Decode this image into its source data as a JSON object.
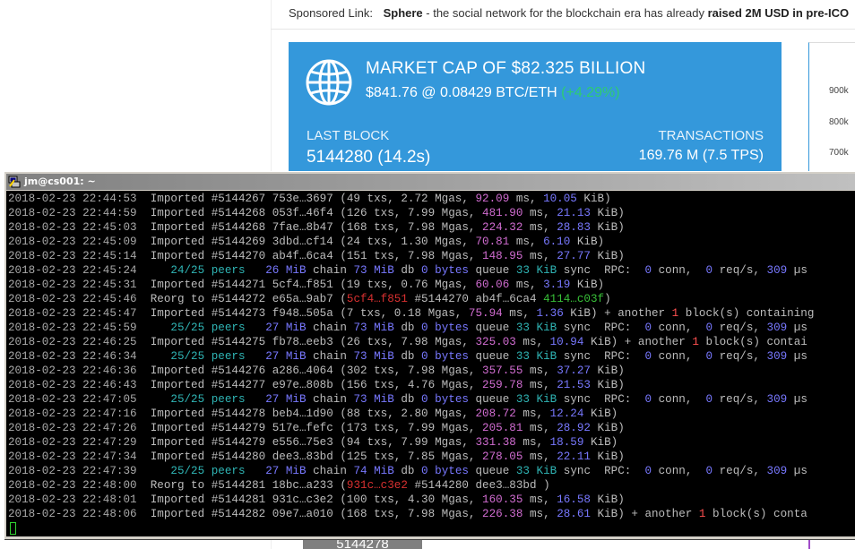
{
  "sponsor": {
    "label": "Sponsored Link:",
    "name": "Sphere",
    "text": " - the social network for the blockchain era has already ",
    "bold_tail": "raised 2M USD in pre-ICO"
  },
  "market": {
    "title": "MARKET CAP OF $82.325 BILLION",
    "price": "$841.76 @ 0.08429 BTC/ETH",
    "change": "(+4.29%)",
    "last_block_label": "LAST BLOCK",
    "last_block_value": "5144280 (14.2s)",
    "transactions_label": "TRANSACTIONS",
    "transactions_value": "169.76 M (7.5 TPS)",
    "brand_color": "#3498db",
    "change_color": "#2ecc71"
  },
  "side_chart": {
    "ticks": [
      "900k",
      "800k",
      "700k"
    ]
  },
  "bottom_value": "5144278",
  "terminal": {
    "title": "jm@cs001: ~",
    "lines": [
      [
        [
          "ts",
          "2018-02-23 22:44:53"
        ],
        [
          "w",
          "  Imported #5144267 753e…3697 (49 txs, 2.72 Mgas, "
        ],
        [
          "m",
          "92.09"
        ],
        [
          "w",
          " ms, "
        ],
        [
          "b",
          "10.05"
        ],
        [
          "w",
          " KiB)"
        ]
      ],
      [
        [
          "ts",
          "2018-02-23 22:44:59"
        ],
        [
          "w",
          "  Imported #5144268 053f…46f4 (126 txs, 7.99 Mgas, "
        ],
        [
          "m",
          "481.90"
        ],
        [
          "w",
          " ms, "
        ],
        [
          "b",
          "21.13"
        ],
        [
          "w",
          " KiB)"
        ]
      ],
      [
        [
          "ts",
          "2018-02-23 22:45:03"
        ],
        [
          "w",
          "  Imported #5144268 7fae…8b47 (168 txs, 7.98 Mgas, "
        ],
        [
          "m",
          "224.32"
        ],
        [
          "w",
          " ms, "
        ],
        [
          "b",
          "28.83"
        ],
        [
          "w",
          " KiB)"
        ]
      ],
      [
        [
          "ts",
          "2018-02-23 22:45:09"
        ],
        [
          "w",
          "  Imported #5144269 3dbd…cf14 (24 txs, 1.30 Mgas, "
        ],
        [
          "m",
          "70.81"
        ],
        [
          "w",
          " ms, "
        ],
        [
          "b",
          "6.10"
        ],
        [
          "w",
          " KiB)"
        ]
      ],
      [
        [
          "ts",
          "2018-02-23 22:45:14"
        ],
        [
          "w",
          "  Imported #5144270 ab4f…6ca4 (151 txs, 7.98 Mgas, "
        ],
        [
          "m",
          "148.95"
        ],
        [
          "w",
          " ms, "
        ],
        [
          "b",
          "27.77"
        ],
        [
          "w",
          " KiB)"
        ]
      ],
      [
        [
          "ts",
          "2018-02-23 22:45:24"
        ],
        [
          "c",
          "     24/25 peers"
        ],
        [
          "b",
          "   26 MiB"
        ],
        [
          "w",
          " chain "
        ],
        [
          "b",
          "73 MiB"
        ],
        [
          "w",
          " db "
        ],
        [
          "b",
          "0 bytes"
        ],
        [
          "w",
          " queue "
        ],
        [
          "c",
          "33 KiB"
        ],
        [
          "w",
          " sync  RPC:  "
        ],
        [
          "b",
          "0"
        ],
        [
          "w",
          " conn,  "
        ],
        [
          "b",
          "0"
        ],
        [
          "w",
          " req/s, "
        ],
        [
          "b",
          "309"
        ],
        [
          "w",
          " µs"
        ]
      ],
      [
        [
          "ts",
          "2018-02-23 22:45:31"
        ],
        [
          "w",
          "  Imported #5144271 5cf4…f851 (19 txs, 0.76 Mgas, "
        ],
        [
          "m",
          "60.06"
        ],
        [
          "w",
          " ms, "
        ],
        [
          "b",
          "3.19"
        ],
        [
          "w",
          " KiB)"
        ]
      ],
      [
        [
          "ts",
          "2018-02-23 22:45:46"
        ],
        [
          "w",
          "  Reorg to #5144272 e65a…9ab7 ("
        ],
        [
          "r",
          "5cf4…f851"
        ],
        [
          "w",
          " #5144270 ab4f…6ca4 "
        ],
        [
          "g",
          "4114…c03f"
        ],
        [
          "w",
          ")"
        ]
      ],
      [
        [
          "ts",
          "2018-02-23 22:45:47"
        ],
        [
          "w",
          "  Imported #5144273 f948…505a (7 txs, 0.18 Mgas, "
        ],
        [
          "m",
          "75.94"
        ],
        [
          "w",
          " ms, "
        ],
        [
          "b",
          "1.36"
        ],
        [
          "w",
          " KiB) + another "
        ],
        [
          "rm",
          "1"
        ],
        [
          "w",
          " block(s) containing"
        ]
      ],
      [
        [
          "ts",
          "2018-02-23 22:45:59"
        ],
        [
          "c",
          "     25/25 peers"
        ],
        [
          "b",
          "   27 MiB"
        ],
        [
          "w",
          " chain "
        ],
        [
          "b",
          "73 MiB"
        ],
        [
          "w",
          " db "
        ],
        [
          "b",
          "0 bytes"
        ],
        [
          "w",
          " queue "
        ],
        [
          "c",
          "33 KiB"
        ],
        [
          "w",
          " sync  RPC:  "
        ],
        [
          "b",
          "0"
        ],
        [
          "w",
          " conn,  "
        ],
        [
          "b",
          "0"
        ],
        [
          "w",
          " req/s, "
        ],
        [
          "b",
          "309"
        ],
        [
          "w",
          " µs"
        ]
      ],
      [
        [
          "ts",
          "2018-02-23 22:46:25"
        ],
        [
          "w",
          "  Imported #5144275 fb78…eeb3 (26 txs, 7.98 Mgas, "
        ],
        [
          "m",
          "325.03"
        ],
        [
          "w",
          " ms, "
        ],
        [
          "b",
          "10.94"
        ],
        [
          "w",
          " KiB) + another "
        ],
        [
          "rm",
          "1"
        ],
        [
          "w",
          " block(s) contai"
        ]
      ],
      [
        [
          "ts",
          "2018-02-23 22:46:34"
        ],
        [
          "c",
          "     25/25 peers"
        ],
        [
          "b",
          "   27 MiB"
        ],
        [
          "w",
          " chain "
        ],
        [
          "b",
          "73 MiB"
        ],
        [
          "w",
          " db "
        ],
        [
          "b",
          "0 bytes"
        ],
        [
          "w",
          " queue "
        ],
        [
          "c",
          "33 KiB"
        ],
        [
          "w",
          " sync  RPC:  "
        ],
        [
          "b",
          "0"
        ],
        [
          "w",
          " conn,  "
        ],
        [
          "b",
          "0"
        ],
        [
          "w",
          " req/s, "
        ],
        [
          "b",
          "309"
        ],
        [
          "w",
          " µs"
        ]
      ],
      [
        [
          "ts",
          "2018-02-23 22:46:36"
        ],
        [
          "w",
          "  Imported #5144276 a286…4064 (302 txs, 7.98 Mgas, "
        ],
        [
          "m",
          "357.55"
        ],
        [
          "w",
          " ms, "
        ],
        [
          "b",
          "37.27"
        ],
        [
          "w",
          " KiB)"
        ]
      ],
      [
        [
          "ts",
          "2018-02-23 22:46:43"
        ],
        [
          "w",
          "  Imported #5144277 e97e…808b (156 txs, 4.76 Mgas, "
        ],
        [
          "m",
          "259.78"
        ],
        [
          "w",
          " ms, "
        ],
        [
          "b",
          "21.53"
        ],
        [
          "w",
          " KiB)"
        ]
      ],
      [
        [
          "ts",
          "2018-02-23 22:47:05"
        ],
        [
          "c",
          "     25/25 peers"
        ],
        [
          "b",
          "   27 MiB"
        ],
        [
          "w",
          " chain "
        ],
        [
          "b",
          "73 MiB"
        ],
        [
          "w",
          " db "
        ],
        [
          "b",
          "0 bytes"
        ],
        [
          "w",
          " queue "
        ],
        [
          "c",
          "33 KiB"
        ],
        [
          "w",
          " sync  RPC:  "
        ],
        [
          "b",
          "0"
        ],
        [
          "w",
          " conn,  "
        ],
        [
          "b",
          "0"
        ],
        [
          "w",
          " req/s, "
        ],
        [
          "b",
          "309"
        ],
        [
          "w",
          " µs"
        ]
      ],
      [
        [
          "ts",
          "2018-02-23 22:47:16"
        ],
        [
          "w",
          "  Imported #5144278 beb4…1d90 (88 txs, 2.80 Mgas, "
        ],
        [
          "m",
          "208.72"
        ],
        [
          "w",
          " ms, "
        ],
        [
          "b",
          "12.24"
        ],
        [
          "w",
          " KiB)"
        ]
      ],
      [
        [
          "ts",
          "2018-02-23 22:47:26"
        ],
        [
          "w",
          "  Imported #5144279 517e…fefc (173 txs, 7.99 Mgas, "
        ],
        [
          "m",
          "205.81"
        ],
        [
          "w",
          " ms, "
        ],
        [
          "b",
          "28.92"
        ],
        [
          "w",
          " KiB)"
        ]
      ],
      [
        [
          "ts",
          "2018-02-23 22:47:29"
        ],
        [
          "w",
          "  Imported #5144279 e556…75e3 (94 txs, 7.99 Mgas, "
        ],
        [
          "m",
          "331.38"
        ],
        [
          "w",
          " ms, "
        ],
        [
          "b",
          "18.59"
        ],
        [
          "w",
          " KiB)"
        ]
      ],
      [
        [
          "ts",
          "2018-02-23 22:47:34"
        ],
        [
          "w",
          "  Imported #5144280 dee3…83bd (125 txs, 7.85 Mgas, "
        ],
        [
          "m",
          "278.05"
        ],
        [
          "w",
          " ms, "
        ],
        [
          "b",
          "22.11"
        ],
        [
          "w",
          " KiB)"
        ]
      ],
      [
        [
          "ts",
          "2018-02-23 22:47:39"
        ],
        [
          "c",
          "     25/25 peers"
        ],
        [
          "b",
          "   27 MiB"
        ],
        [
          "w",
          " chain "
        ],
        [
          "b",
          "74 MiB"
        ],
        [
          "w",
          " db "
        ],
        [
          "b",
          "0 bytes"
        ],
        [
          "w",
          " queue "
        ],
        [
          "c",
          "33 KiB"
        ],
        [
          "w",
          " sync  RPC:  "
        ],
        [
          "b",
          "0"
        ],
        [
          "w",
          " conn,  "
        ],
        [
          "b",
          "0"
        ],
        [
          "w",
          " req/s, "
        ],
        [
          "b",
          "309"
        ],
        [
          "w",
          " µs"
        ]
      ],
      [
        [
          "ts",
          "2018-02-23 22:48:00"
        ],
        [
          "w",
          "  Reorg to #5144281 18bc…a233 ("
        ],
        [
          "r",
          "931c…c3e2"
        ],
        [
          "w",
          " #5144280 dee3…83bd )"
        ]
      ],
      [
        [
          "ts",
          "2018-02-23 22:48:01"
        ],
        [
          "w",
          "  Imported #5144281 931c…c3e2 (100 txs, 4.30 Mgas, "
        ],
        [
          "m",
          "160.35"
        ],
        [
          "w",
          " ms, "
        ],
        [
          "b",
          "16.58"
        ],
        [
          "w",
          " KiB)"
        ]
      ],
      [
        [
          "ts",
          "2018-02-23 22:48:06"
        ],
        [
          "w",
          "  Imported #5144282 09e7…a010 (168 txs, 7.98 Mgas, "
        ],
        [
          "m",
          "226.38"
        ],
        [
          "w",
          " ms, "
        ],
        [
          "b",
          "28.61"
        ],
        [
          "w",
          " KiB) + another "
        ],
        [
          "rm",
          "1"
        ],
        [
          "w",
          " block(s) conta"
        ]
      ]
    ]
  }
}
